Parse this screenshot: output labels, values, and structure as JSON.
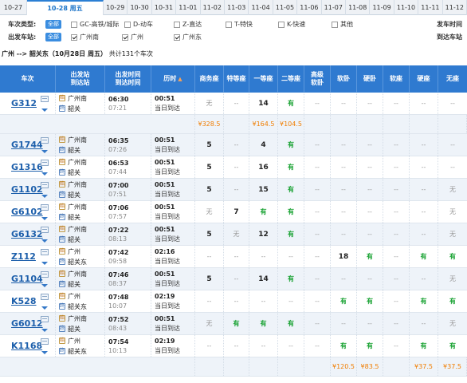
{
  "date_tabs": [
    {
      "label": "10-27",
      "active": false
    },
    {
      "label": "10-28 周五",
      "active": true
    },
    {
      "label": "10-29",
      "active": false
    },
    {
      "label": "10-30",
      "active": false
    },
    {
      "label": "10-31",
      "active": false
    },
    {
      "label": "11-01",
      "active": false
    },
    {
      "label": "11-02",
      "active": false
    },
    {
      "label": "11-03",
      "active": false
    },
    {
      "label": "11-04",
      "active": false
    },
    {
      "label": "11-05",
      "active": false
    },
    {
      "label": "11-06",
      "active": false
    },
    {
      "label": "11-07",
      "active": false
    },
    {
      "label": "11-08",
      "active": false
    },
    {
      "label": "11-09",
      "active": false
    },
    {
      "label": "11-10",
      "active": false
    },
    {
      "label": "11-11",
      "active": false
    },
    {
      "label": "11-12",
      "active": false
    }
  ],
  "filters": {
    "train_type_label": "车次类型:",
    "all_label": "全部",
    "train_types": [
      {
        "label": "GC-高铁/城际",
        "checked": false
      },
      {
        "label": "D-动车",
        "checked": false
      },
      {
        "label": "Z-直达",
        "checked": false
      },
      {
        "label": "T-特快",
        "checked": false
      },
      {
        "label": "K-快速",
        "checked": false
      },
      {
        "label": "其他",
        "checked": false
      }
    ],
    "depart_time_label": "发车时间",
    "station_label": "出发车站:",
    "stations": [
      {
        "label": "广州南",
        "checked": true
      },
      {
        "label": "广州",
        "checked": true
      },
      {
        "label": "广州东",
        "checked": true
      }
    ],
    "arrive_station_label": "到达车站"
  },
  "summary": {
    "route": "广州 --> 韶关东（10月28日 周五）",
    "count": "共计131个车次"
  },
  "headers": {
    "train": "车次",
    "from": "出发站",
    "to": "到达站",
    "dep_time": "出发时间",
    "arr_time": "到达时间",
    "duration": "历时",
    "business": "商务座",
    "special": "特等座",
    "first": "一等座",
    "second": "二等座",
    "premium_sleeper_1": "高级",
    "premium_sleeper_2": "软卧",
    "soft_sleeper": "软卧",
    "hard_sleeper": "硬卧",
    "soft_seat": "软座",
    "hard_seat": "硬座",
    "no_seat": "无座"
  },
  "rows": [
    {
      "train": "G312",
      "from": "广州南",
      "to": "韶关",
      "dep": "06:30",
      "arr": "07:21",
      "dur": "00:51",
      "day": "当日到达",
      "seats": [
        "无",
        "--",
        "14",
        "有",
        "--",
        "--",
        "--",
        "--",
        "--",
        "--",
        "--"
      ]
    },
    {
      "price_row": true,
      "prices": [
        "¥328.5",
        "",
        "¥164.5",
        "¥104.5",
        "",
        "",
        "",
        "",
        "",
        "",
        ""
      ]
    },
    {
      "train": "G1744",
      "from": "广州南",
      "to": "韶关",
      "dep": "06:35",
      "arr": "07:26",
      "dur": "00:51",
      "day": "当日到达",
      "seats": [
        "5",
        "--",
        "4",
        "有",
        "--",
        "--",
        "--",
        "--",
        "--",
        "--",
        "--"
      ]
    },
    {
      "train": "G1316",
      "from": "广州南",
      "to": "韶关",
      "dep": "06:53",
      "arr": "07:44",
      "dur": "00:51",
      "day": "当日到达",
      "seats": [
        "5",
        "--",
        "16",
        "有",
        "--",
        "--",
        "--",
        "--",
        "--",
        "--",
        "--"
      ]
    },
    {
      "train": "G1102",
      "from": "广州南",
      "to": "韶关",
      "dep": "07:00",
      "arr": "07:51",
      "dur": "00:51",
      "day": "当日到达",
      "seats": [
        "5",
        "--",
        "15",
        "有",
        "--",
        "--",
        "--",
        "--",
        "--",
        "--",
        "无"
      ]
    },
    {
      "train": "G6102",
      "from": "广州南",
      "to": "韶关",
      "dep": "07:06",
      "arr": "07:57",
      "dur": "00:51",
      "day": "当日到达",
      "seats": [
        "无",
        "7",
        "有",
        "有",
        "--",
        "--",
        "--",
        "--",
        "--",
        "--",
        "无"
      ]
    },
    {
      "train": "G6132",
      "from": "广州南",
      "to": "韶关",
      "dep": "07:22",
      "arr": "08:13",
      "dur": "00:51",
      "day": "当日到达",
      "seats": [
        "5",
        "无",
        "12",
        "有",
        "--",
        "--",
        "--",
        "--",
        "--",
        "--",
        "无"
      ]
    },
    {
      "train": "Z112",
      "from": "广州",
      "to": "韶关东",
      "dep": "07:42",
      "arr": "09:58",
      "dur": "02:16",
      "day": "当日到达",
      "seats": [
        "--",
        "--",
        "--",
        "--",
        "--",
        "18",
        "有",
        "--",
        "有",
        "--",
        "有"
      ]
    },
    {
      "train": "G1104",
      "from": "广州南",
      "to": "韶关",
      "dep": "07:46",
      "arr": "08:37",
      "dur": "00:51",
      "day": "当日到达",
      "seats": [
        "5",
        "--",
        "14",
        "有",
        "--",
        "--",
        "--",
        "--",
        "--",
        "--",
        "无"
      ]
    },
    {
      "train": "K528",
      "from": "广州",
      "to": "韶关东",
      "dep": "07:48",
      "arr": "10:07",
      "dur": "02:19",
      "day": "当日到达",
      "seats": [
        "--",
        "--",
        "--",
        "--",
        "--",
        "有",
        "有",
        "--",
        "有",
        "--",
        "有"
      ]
    },
    {
      "train": "G6012",
      "from": "广州南",
      "to": "韶关",
      "dep": "07:52",
      "arr": "08:43",
      "dur": "00:51",
      "day": "当日到达",
      "seats": [
        "无",
        "有",
        "有",
        "有",
        "--",
        "--",
        "--",
        "--",
        "--",
        "--",
        "无"
      ]
    },
    {
      "train": "K1168",
      "from": "广州",
      "to": "韶关东",
      "dep": "07:54",
      "arr": "10:13",
      "dur": "02:19",
      "day": "当日到达",
      "seats": [
        "--",
        "--",
        "--",
        "--",
        "--",
        "有",
        "有",
        "--",
        "有",
        "--",
        "有"
      ]
    },
    {
      "price_row": true,
      "prices": [
        "",
        "",
        "",
        "",
        "",
        "¥120.5",
        "¥83.5",
        "",
        "¥37.5",
        "",
        "¥37.5"
      ]
    }
  ]
}
